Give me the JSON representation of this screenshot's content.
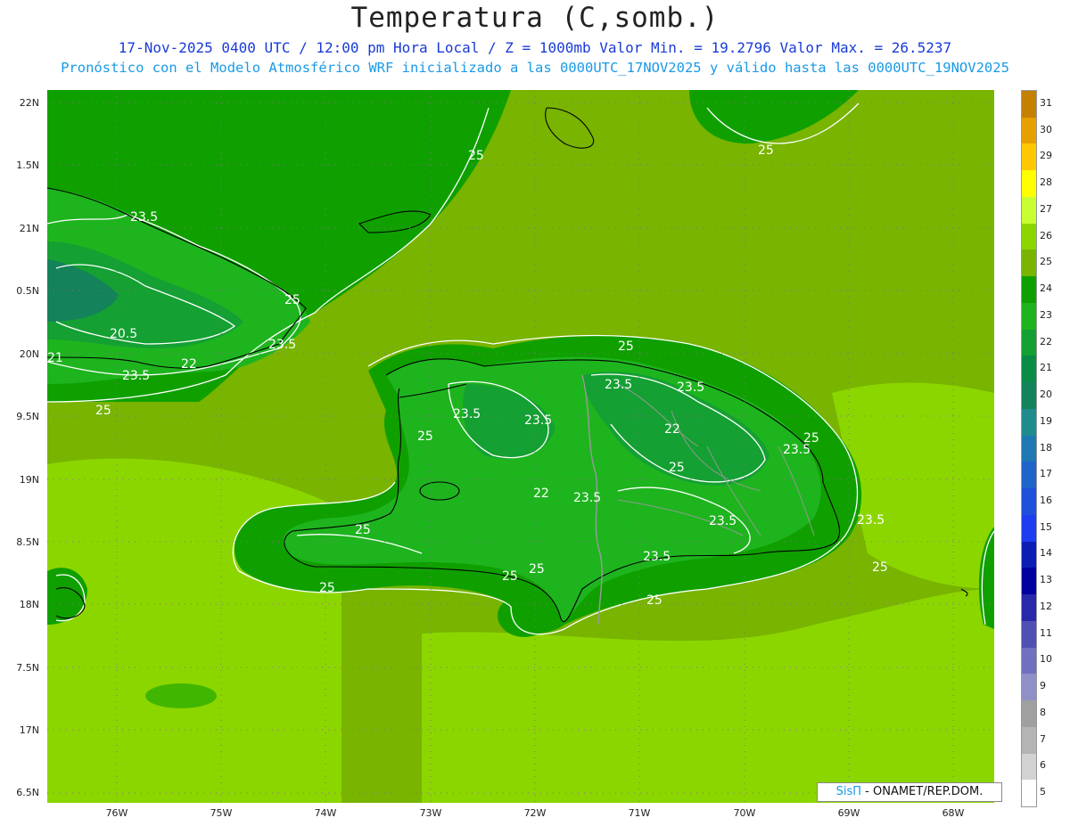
{
  "header": {
    "title": "Temperatura (C,somb.)",
    "subtitle1": "17-Nov-2025 0400 UTC / 12:00 pm Hora Local / Z = 1000mb  Valor Min. = 19.2796  Valor Max. = 26.5237",
    "subtitle2": "Pronóstico con el Modelo Atmosférico WRF inicializado a las 0000UTC_17NOV2025 y válido hasta las  0000UTC_19NOV2025"
  },
  "axes": {
    "lat_labels": [
      "22N",
      "21.5N",
      "21N",
      "20.5N",
      "20N",
      "19.5N",
      "19N",
      "18.5N",
      "18N",
      "17.5N",
      "17N",
      "16.5N"
    ],
    "lat_labels_display": [
      "22N",
      "1.5N",
      "21N",
      "0.5N",
      "20N",
      "9.5N",
      "19N",
      "8.5N",
      "18N",
      "7.5N",
      "17N",
      "6.5N"
    ],
    "lon_labels": [
      "76W",
      "75W",
      "74W",
      "73W",
      "72W",
      "71W",
      "70W",
      "69W",
      "68W"
    ]
  },
  "colorbar": {
    "labels": [
      "31",
      "30",
      "29",
      "28",
      "27",
      "26",
      "25",
      "24",
      "23",
      "22",
      "21",
      "20",
      "19",
      "18",
      "17",
      "16",
      "15",
      "14",
      "13",
      "12",
      "11",
      "10",
      "9",
      "8",
      "7",
      "6",
      "5"
    ],
    "colors": [
      "#c48000",
      "#e6a000",
      "#ffc800",
      "#ffff00",
      "#c8ff32",
      "#8cd600",
      "#78b400",
      "#0fa000",
      "#1eb41e",
      "#14a032",
      "#0a8c46",
      "#14825a",
      "#1e8c8c",
      "#1e78b4",
      "#1e64c8",
      "#1e50dc",
      "#1e3cf0",
      "#0a1eb4",
      "#0000a0",
      "#2828aa",
      "#5050b4",
      "#7070be",
      "#9090c8",
      "#a0a0a0",
      "#b4b4b4",
      "#d2d2d2",
      "#ffffff"
    ]
  },
  "contour_labels": [
    "25",
    "25",
    "23.5",
    "25",
    "20.5",
    "23.5",
    "23.5",
    "22",
    "21",
    "25",
    "23.5",
    "25",
    "23.5",
    "23.5",
    "25",
    "23.5",
    "22",
    "25",
    "25",
    "23.5",
    "22",
    "23.5",
    "25",
    "25",
    "23.5",
    "25",
    "25",
    "23.5",
    "23.5",
    "25",
    "25"
  ],
  "credit": {
    "brand": "SisΠ",
    "text": " - ONAMET/REP.DOM."
  }
}
